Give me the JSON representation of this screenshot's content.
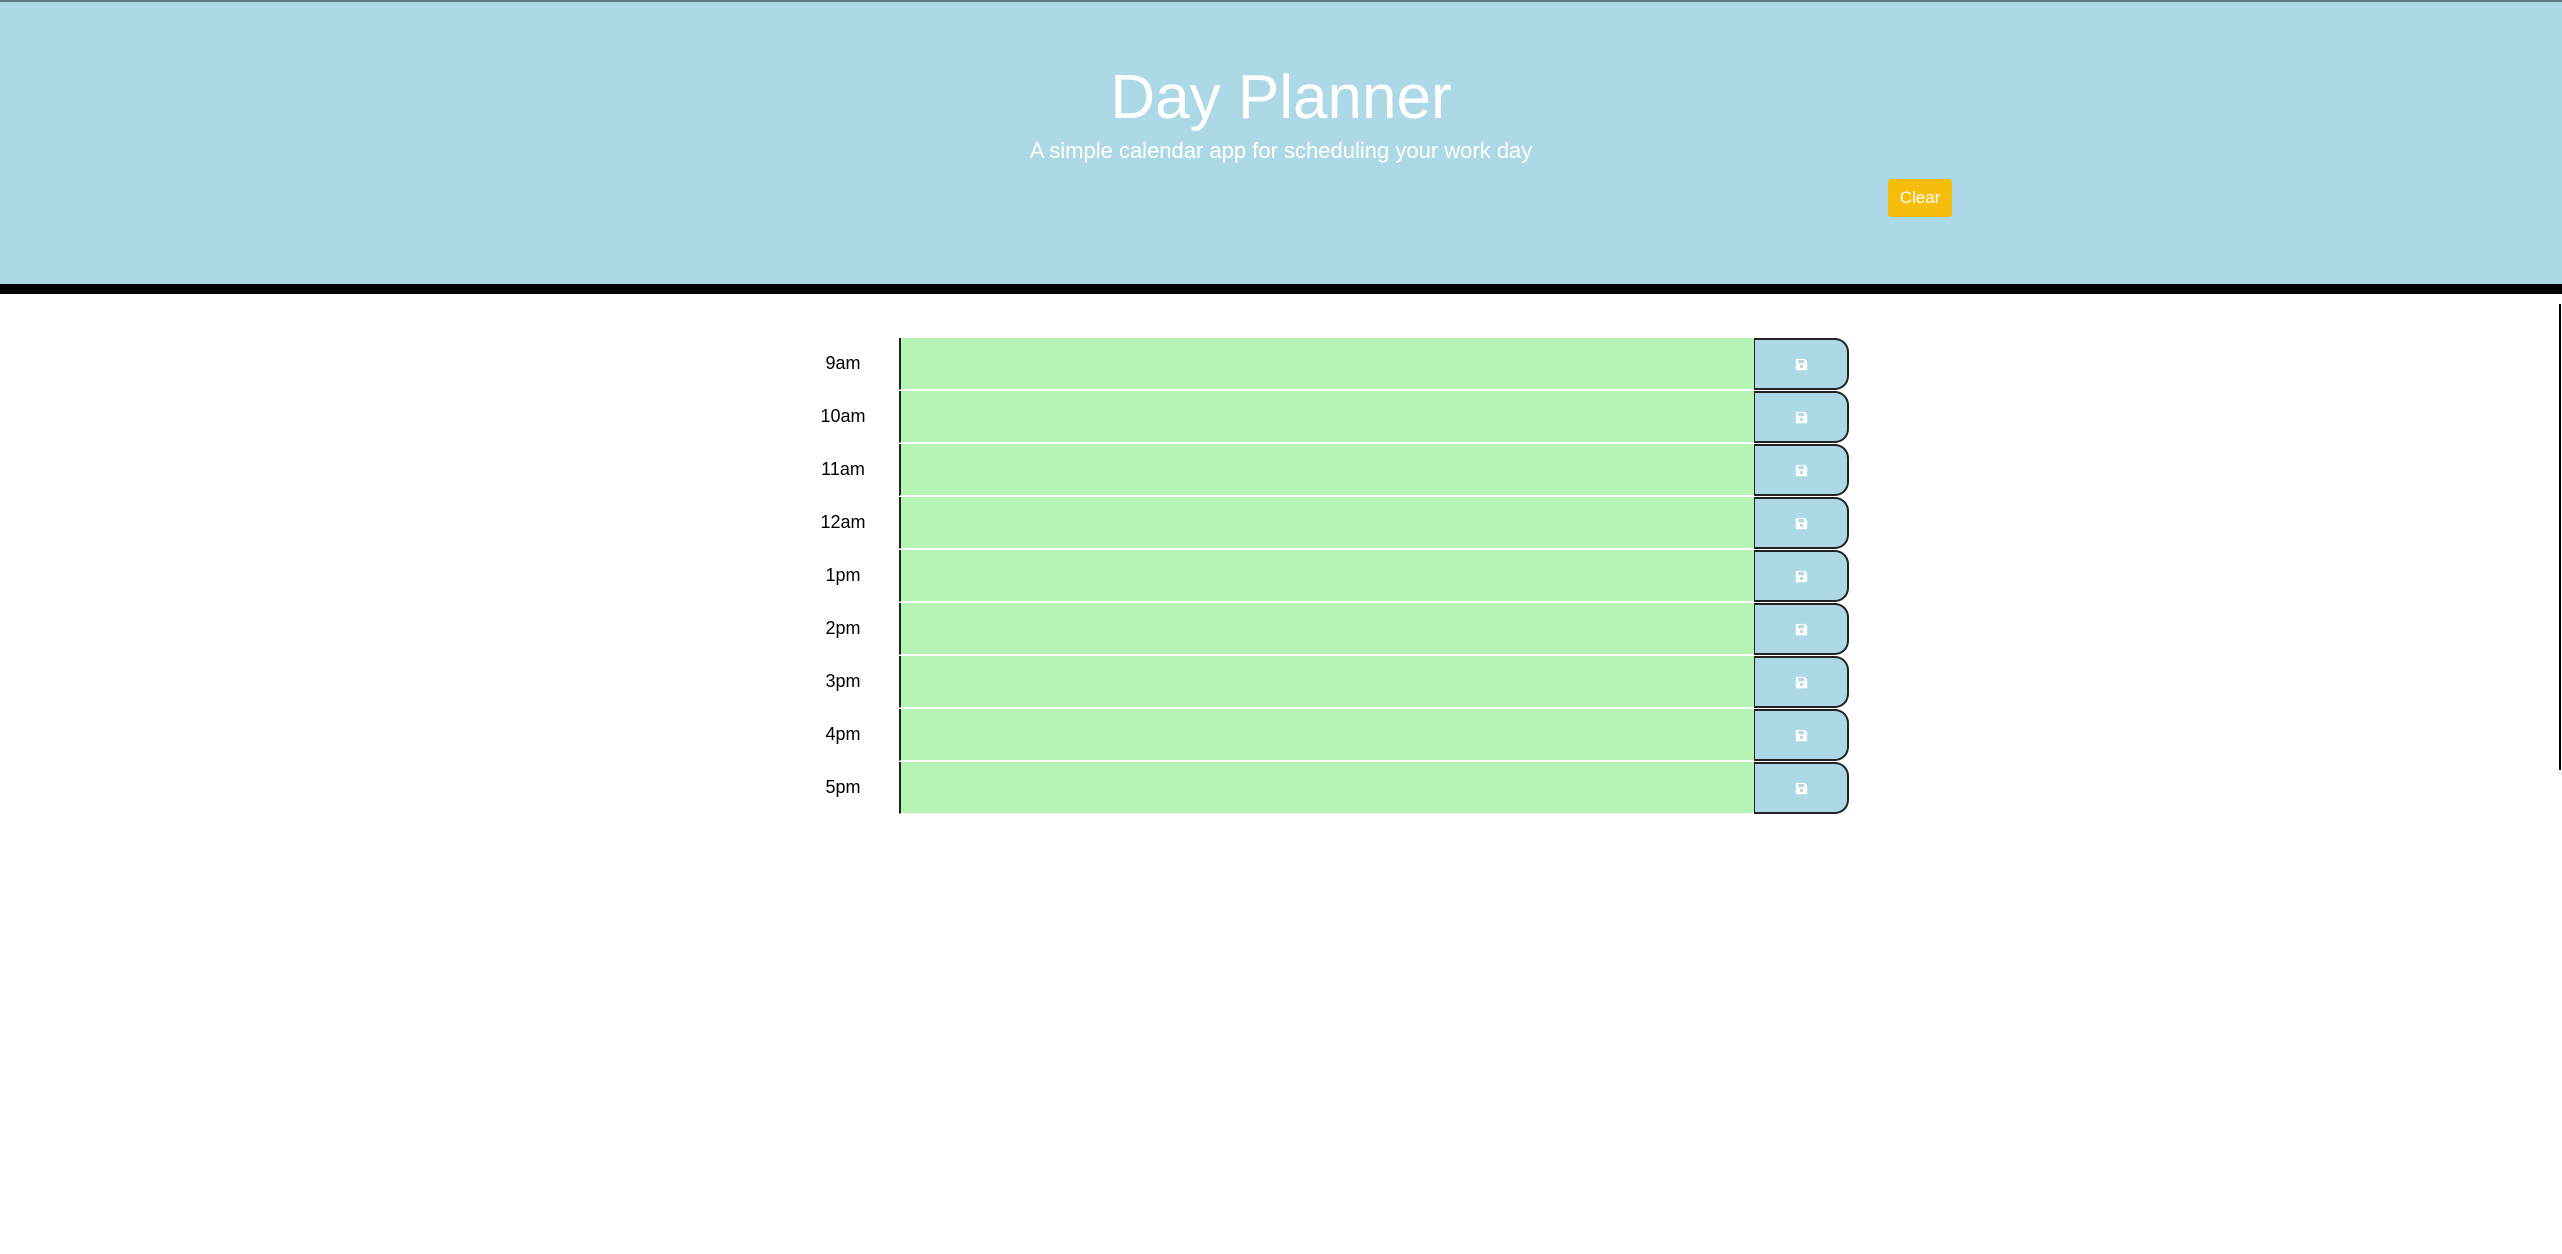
{
  "header": {
    "title": "Day Planner",
    "subtitle": "A simple calendar app for scheduling your work day",
    "clear_label": "Clear"
  },
  "colors": {
    "header_bg": "#add8e6",
    "clear_button": "#f7bd0c",
    "future_slot": "#b6f4b6",
    "save_button": "#add8e6"
  },
  "time_blocks": [
    {
      "hour": "9am",
      "text": "",
      "status": "future"
    },
    {
      "hour": "10am",
      "text": "",
      "status": "future"
    },
    {
      "hour": "11am",
      "text": "",
      "status": "future"
    },
    {
      "hour": "12am",
      "text": "",
      "status": "future"
    },
    {
      "hour": "1pm",
      "text": "",
      "status": "future"
    },
    {
      "hour": "2pm",
      "text": "",
      "status": "future"
    },
    {
      "hour": "3pm",
      "text": "",
      "status": "future"
    },
    {
      "hour": "4pm",
      "text": "",
      "status": "future"
    },
    {
      "hour": "5pm",
      "text": "",
      "status": "future"
    }
  ],
  "icons": {
    "save": "floppy-disk-icon"
  }
}
